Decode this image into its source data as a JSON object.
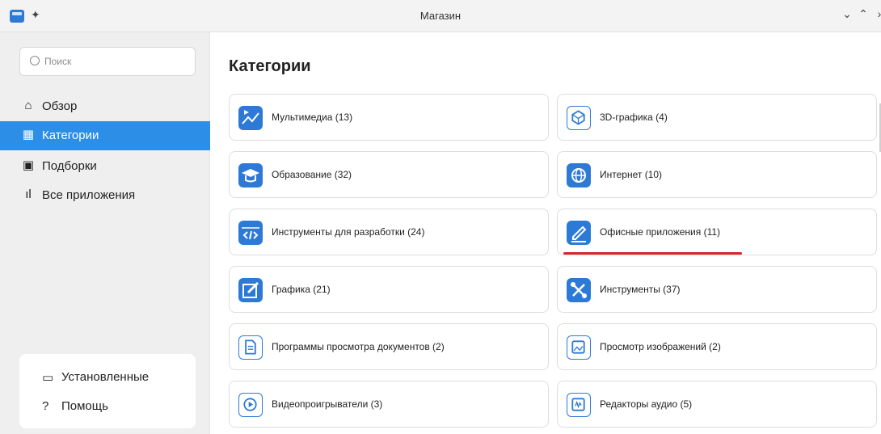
{
  "window": {
    "title": "Магазин",
    "controls": {
      "minimize": "⌄",
      "maximize": "⌃",
      "close": "›"
    }
  },
  "sidebar": {
    "search_placeholder": "Поиск",
    "items": [
      {
        "label": "Обзор",
        "icon": "home-icon",
        "glyph": "⌂"
      },
      {
        "label": "Категории",
        "icon": "grid-icon",
        "glyph": "▦"
      },
      {
        "label": "Подборки",
        "icon": "collections-icon",
        "glyph": "▣"
      },
      {
        "label": "Все приложения",
        "icon": "bars-icon",
        "glyph": "ıl"
      }
    ],
    "bottom": [
      {
        "label": "Установленные",
        "icon": "monitor-icon",
        "glyph": "▭"
      },
      {
        "label": "Помощь",
        "icon": "help-icon",
        "glyph": "?"
      }
    ]
  },
  "main": {
    "title": "Категории",
    "categories": [
      {
        "label": "Мультимедиа (13)",
        "icon": "multimedia-icon"
      },
      {
        "label": "3D-графика (4)",
        "icon": "3d-graphics-icon"
      },
      {
        "label": "Образование (32)",
        "icon": "education-icon"
      },
      {
        "label": "Интернет (10)",
        "icon": "globe-icon"
      },
      {
        "label": "Инструменты для разработки (24)",
        "icon": "code-icon"
      },
      {
        "label": "Офисные приложения (11)",
        "icon": "pencil-icon"
      },
      {
        "label": "Графика (21)",
        "icon": "graphics-icon"
      },
      {
        "label": "Инструменты (37)",
        "icon": "tools-icon"
      },
      {
        "label": "Программы просмотра документов (2)",
        "icon": "document-icon"
      },
      {
        "label": "Просмотр изображений (2)",
        "icon": "image-icon"
      },
      {
        "label": "Видеопроигрыватели (3)",
        "icon": "play-icon"
      },
      {
        "label": "Редакторы аудио (5)",
        "icon": "audio-edit-icon"
      }
    ]
  },
  "colors": {
    "accent": "#2d8ee8",
    "icon_blue": "#2d7ad6",
    "highlight_underline": "#d9262a"
  }
}
